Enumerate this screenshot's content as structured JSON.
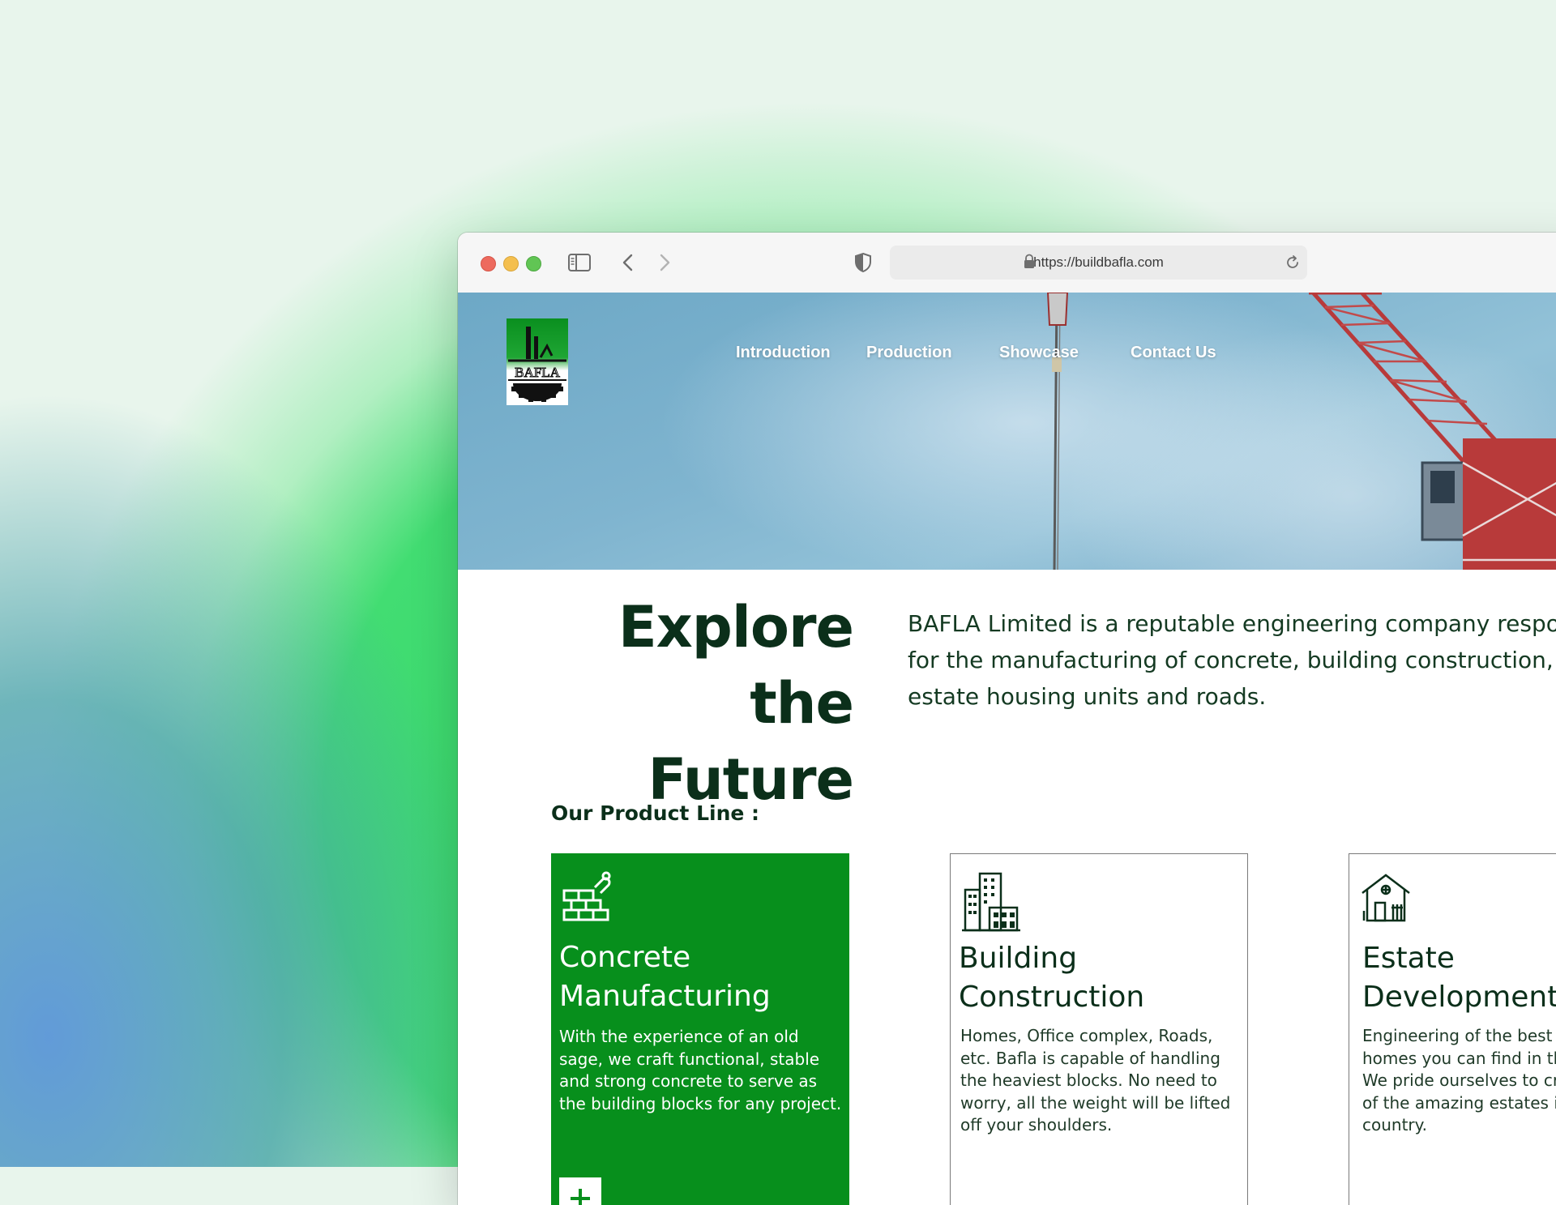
{
  "browser": {
    "url": "https://buildbafla.com"
  },
  "site": {
    "logo_text": "BAFLA",
    "nav": [
      {
        "label": "Introduction"
      },
      {
        "label": "Production"
      },
      {
        "label": "Showcase"
      },
      {
        "label": "Contact Us"
      }
    ]
  },
  "main": {
    "headline_line1": "Explore",
    "headline_line2": "the Future",
    "intro": "BAFLA Limited is a reputable engineering company responsible for the manufacturing of concrete, building construction, real estate housing units and roads.",
    "product_line_title": "Our Product Line :",
    "cards": [
      {
        "icon": "bricks-icon",
        "title": "Concrete Manufacturing",
        "description": "With the experience of an old sage, we craft functional, stable and strong concrete to serve as the building blocks for any project."
      },
      {
        "icon": "buildings-icon",
        "title": "Building Construction",
        "description": "Homes, Office complex, Roads, etc. Bafla is capable of handling the heaviest blocks. No need to worry, all the weight will be lifted off your shoulders."
      },
      {
        "icon": "house-icon",
        "title": "Estate Development",
        "description": "Engineering of the best real estate homes you can find in the country. We pride ourselves to craft some of the amazing estates in the country."
      }
    ]
  },
  "colors": {
    "brand_green": "#078f1c",
    "dark_text": "#0b2f1a",
    "sky": "#7fb4cf",
    "crane_red": "#b83a3a"
  }
}
